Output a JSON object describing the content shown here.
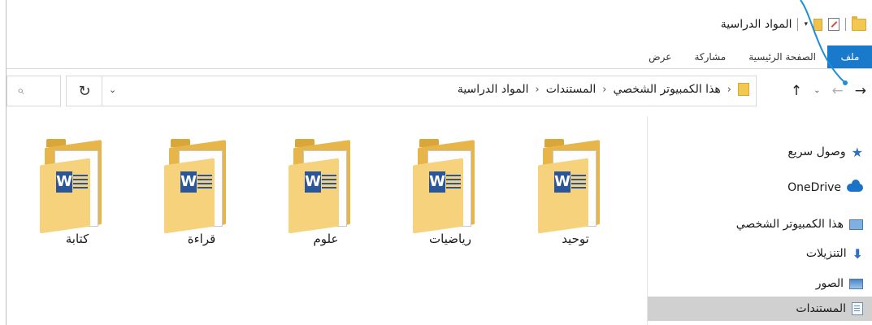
{
  "window": {
    "title": "المواد الدراسية",
    "quick_access_dropdown": "▾"
  },
  "ribbon": {
    "tabs": [
      {
        "label": "ملف"
      },
      {
        "label": "الصفحة الرئيسية"
      },
      {
        "label": "مشاركة"
      },
      {
        "label": "عرض"
      }
    ]
  },
  "nav": {
    "back": "→",
    "forward": "←",
    "recent": "⌄",
    "up": "↑"
  },
  "address": {
    "crumbs": [
      "هذا الكمبيوتر الشخصي",
      "المستندات",
      "المواد الدراسية"
    ],
    "chevron": "›",
    "dropdown": "⌄"
  },
  "search": {
    "icon": "search-icon"
  },
  "refresh": {
    "icon": "refresh-icon",
    "glyph": "↻"
  },
  "folders": [
    {
      "label": "توحيد",
      "icon": "word-folder-icon"
    },
    {
      "label": "رياضيات",
      "icon": "word-folder-icon"
    },
    {
      "label": "علوم",
      "icon": "word-folder-icon"
    },
    {
      "label": "قراءة",
      "icon": "word-folder-icon"
    },
    {
      "label": "كتابة",
      "icon": "word-folder-icon"
    }
  ],
  "navpane": {
    "items": [
      {
        "label": "وصول سريع",
        "icon": "star-icon"
      },
      {
        "label": "OneDrive",
        "icon": "cloud-icon"
      },
      {
        "label": "هذا الكمبيوتر الشخصي",
        "icon": "computer-icon"
      },
      {
        "label": "التنزيلات",
        "icon": "download-icon"
      },
      {
        "label": "الصور",
        "icon": "pictures-icon"
      },
      {
        "label": "المستندات",
        "icon": "documents-icon",
        "selected": true
      }
    ]
  },
  "colors": {
    "accent": "#1979ca",
    "selected_bg": "#d0d0d0",
    "folder": "#f3c852",
    "word": "#2b579a"
  }
}
